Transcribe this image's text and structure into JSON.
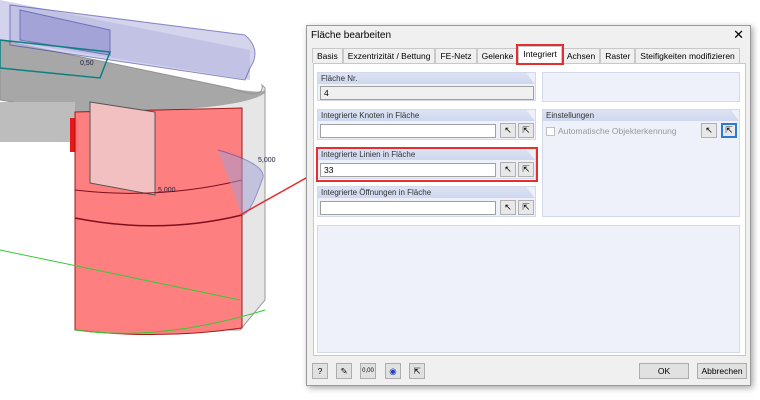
{
  "model": {
    "labels": [
      "0,50",
      "5,000",
      "5,000"
    ]
  },
  "dialog": {
    "title": "Fläche bearbeiten",
    "tabs": [
      "Basis",
      "Exzentrizität / Bettung",
      "FE-Netz",
      "Gelenke",
      "Integriert",
      "Achsen",
      "Raster",
      "Steifigkeiten modifizieren"
    ],
    "active_tab": "Integriert",
    "surface_no": {
      "label": "Fläche Nr.",
      "value": "4"
    },
    "nodes": {
      "label": "Integrierte Knoten in Fläche",
      "value": ""
    },
    "lines": {
      "label": "Integrierte Linien in Fläche",
      "value": "33"
    },
    "openings": {
      "label": "Integrierte Öffnungen in Fläche",
      "value": ""
    },
    "settings": {
      "label": "Einstellungen",
      "auto_detect": "Automatische Objekterkennung",
      "auto_checked": false
    },
    "ok": "OK",
    "cancel": "Abbrechen",
    "accent": "#e03030"
  }
}
